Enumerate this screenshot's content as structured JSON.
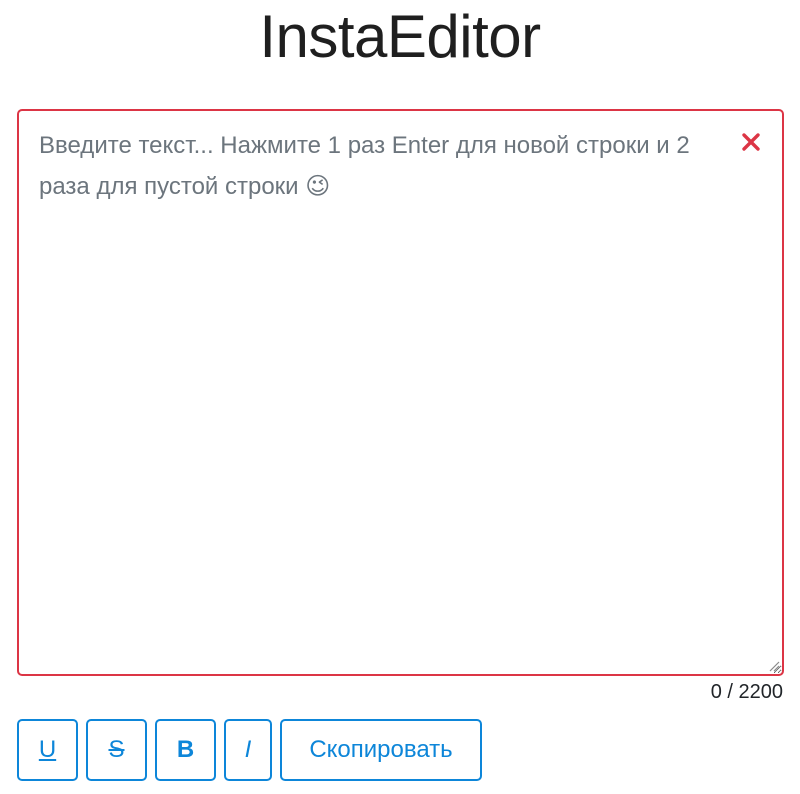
{
  "app": {
    "title": "InstaEditor"
  },
  "editor": {
    "placeholder": "Введите текст... Нажмите 1 раз Enter для новой строки и 2 раза для пустой строки 😉",
    "value": "",
    "clear_symbol": "×",
    "char_count": "0 / 2200"
  },
  "toolbar": {
    "underline_label": "U",
    "strike_label": "S",
    "bold_label": "B",
    "italic_label": "I",
    "copy_label": "Скопировать"
  },
  "colors": {
    "editor_border": "#dc3545",
    "clear_icon": "#dc3545",
    "button_accent": "#0d86d9",
    "placeholder_text": "#6c757d"
  }
}
